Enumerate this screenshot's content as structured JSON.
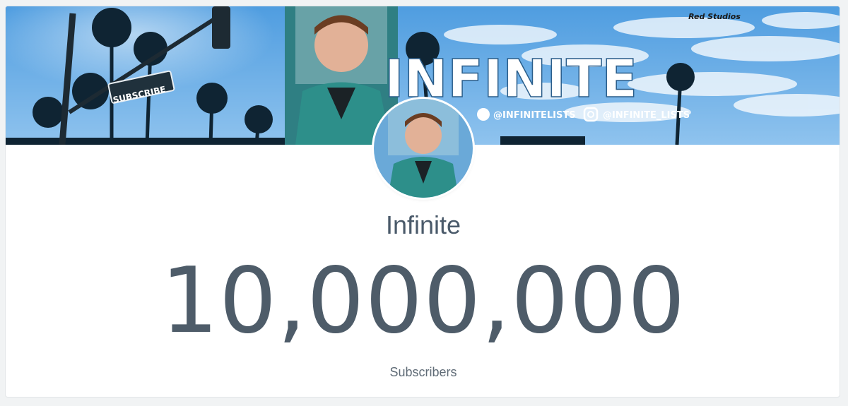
{
  "banner": {
    "street_sign": "SUBSCRIBE",
    "title": "INFINITE",
    "twitter_handle": "@INFINITELISTS",
    "instagram_handle": "@INFINITE_LISTS",
    "watermark": "Red Studios"
  },
  "channel": {
    "name": "Infinite",
    "subscriber_count": "10,000,000",
    "subscriber_label": "Subscribers"
  },
  "colors": {
    "text": "#4e5c69",
    "sky": "#6fb2ea",
    "card": "#ffffff"
  }
}
